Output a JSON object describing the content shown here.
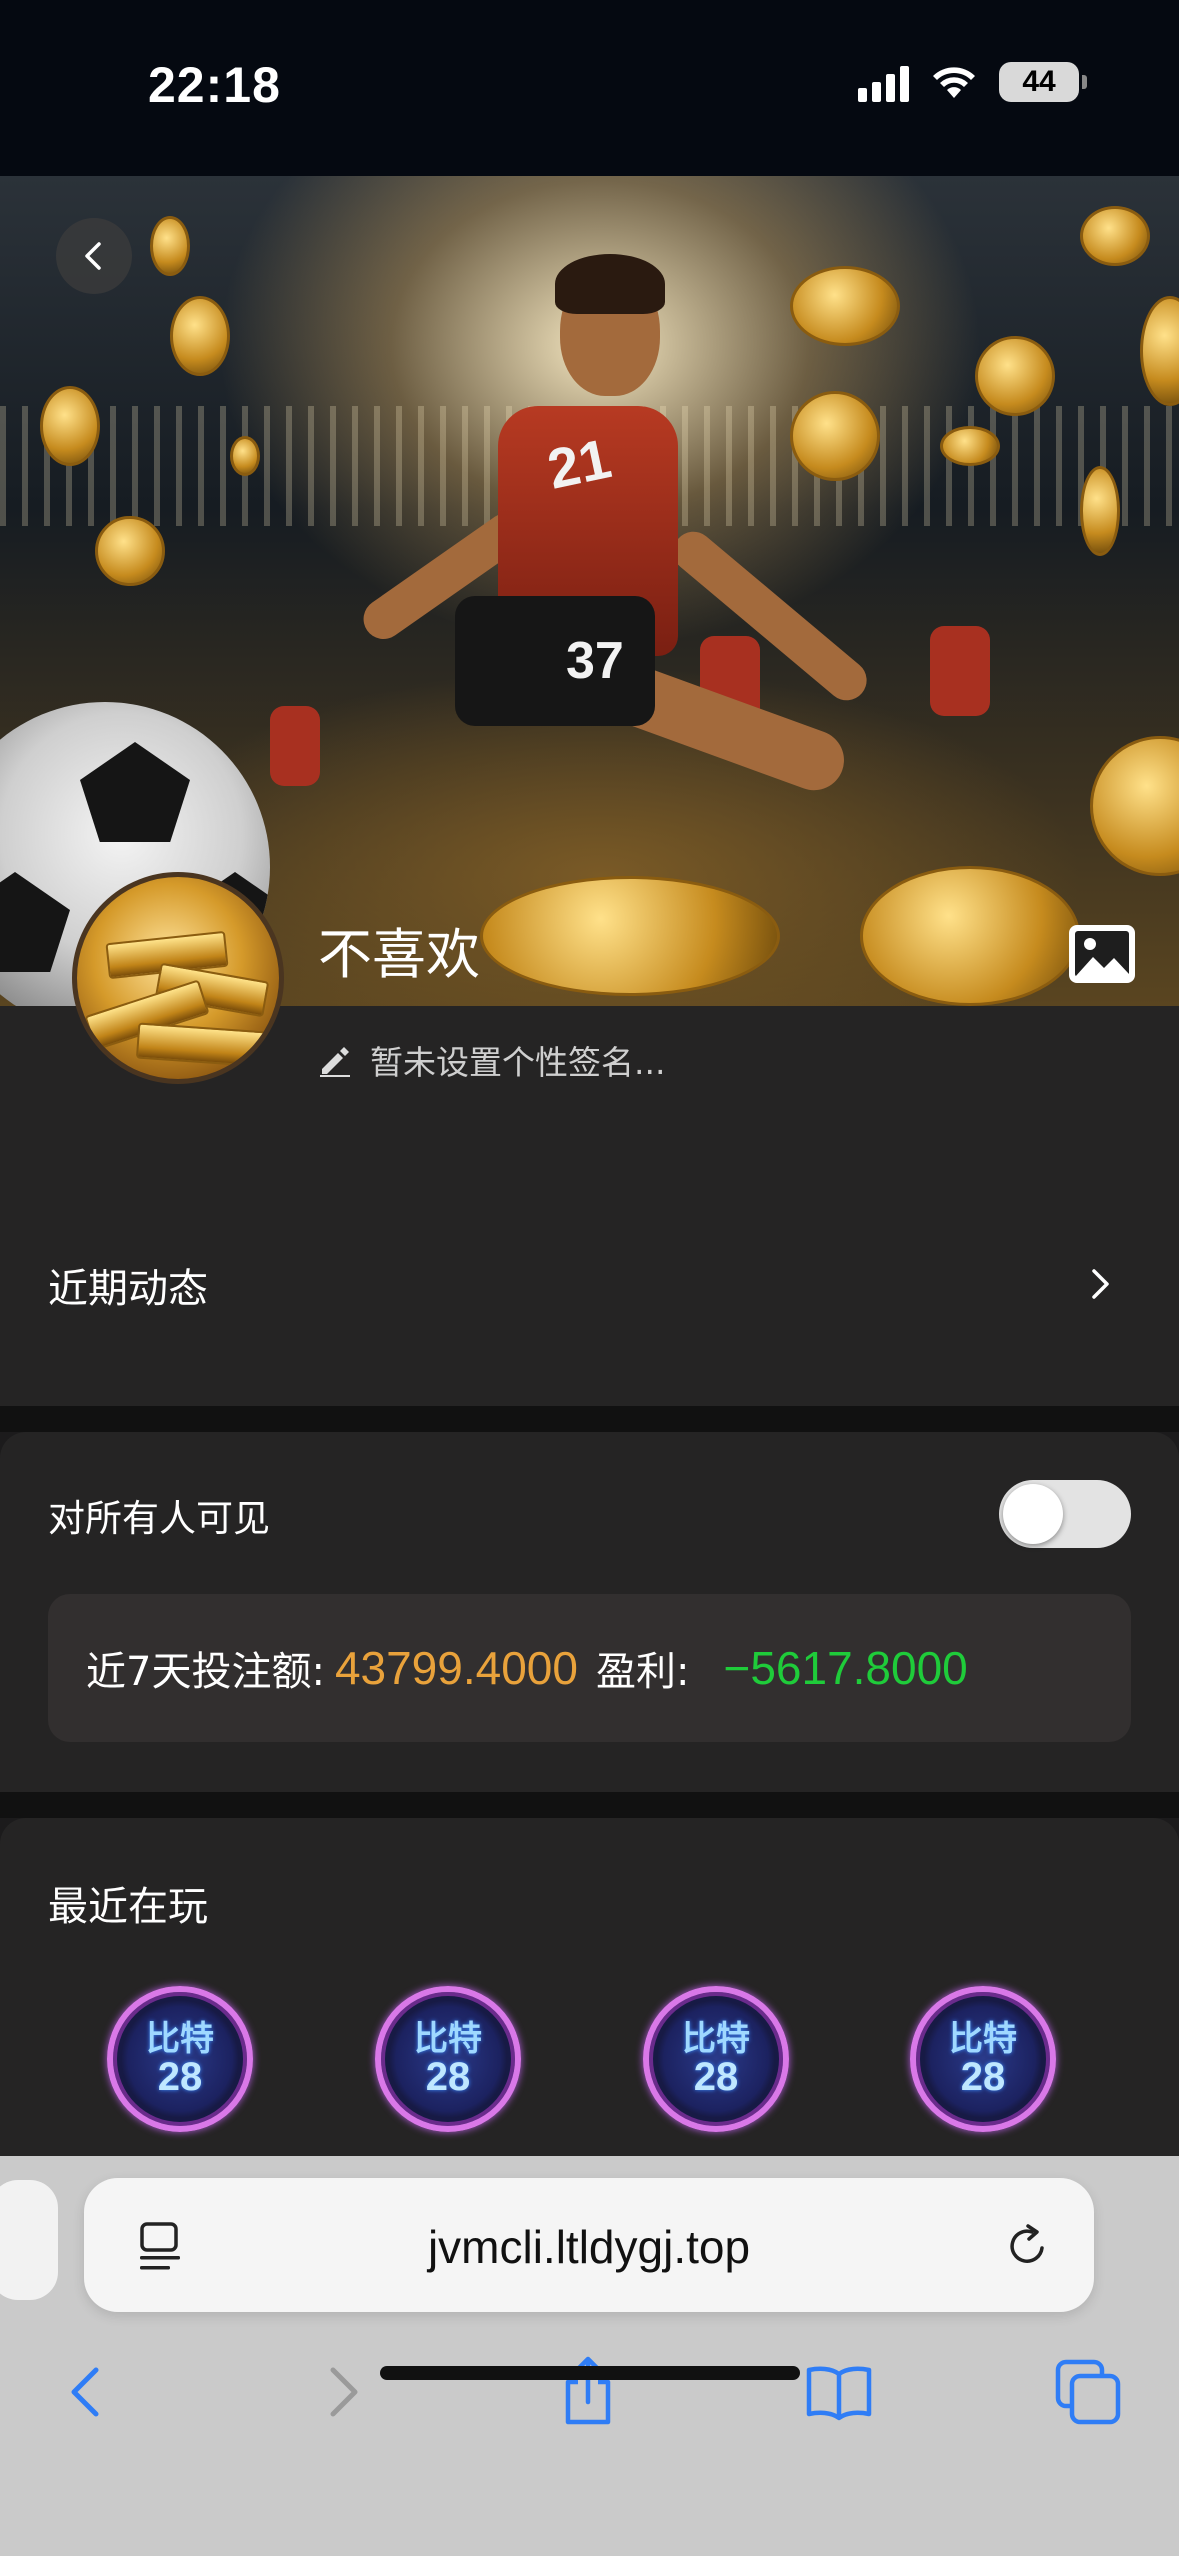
{
  "status_bar": {
    "time": "22:18",
    "battery": "44"
  },
  "profile": {
    "username": "不喜欢",
    "signature": "暂未设置个性签名..."
  },
  "recent_activity": {
    "label": "近期动态"
  },
  "visibility": {
    "label": "对所有人可见",
    "enabled": false
  },
  "stats": {
    "bet_label": "近7天投注额:",
    "bet_value": "43799.4000",
    "profit_label": "盈利:",
    "profit_value": "−5617.8000",
    "colors": {
      "bet": "#e9a23b",
      "profit": "#1fcc3a"
    }
  },
  "recent_games": {
    "title": "最近在玩",
    "games": [
      {
        "line1": "比特",
        "line2": "28"
      },
      {
        "line1": "比特",
        "line2": "28"
      },
      {
        "line1": "比特",
        "line2": "28"
      },
      {
        "line1": "比特",
        "line2": "28"
      }
    ]
  },
  "hero": {
    "jersey_front": "21",
    "shorts": "37"
  },
  "browser": {
    "url": "jvmcli.ltldygj.top",
    "accent": "#2f7df6"
  }
}
